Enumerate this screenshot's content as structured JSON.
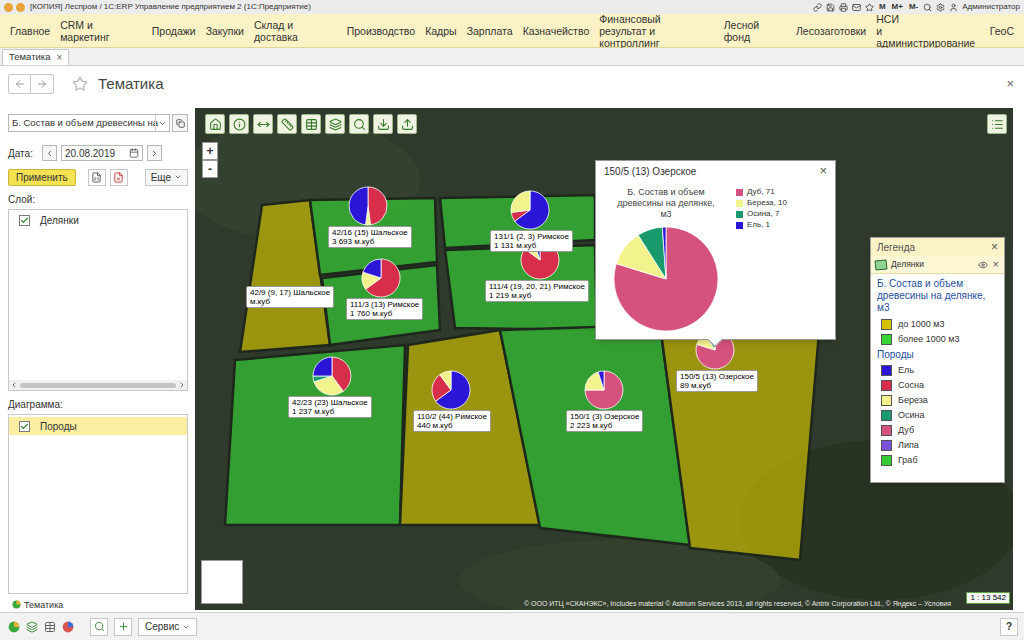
{
  "window": {
    "title": "[КОПИЯ] Леспром / 1С:ERP Управление предприятием 2 (1С:Предприятие)",
    "memory_buttons": [
      "M",
      "M+",
      "M-"
    ],
    "user": "Администратор"
  },
  "menu": [
    {
      "label": "Главное"
    },
    {
      "label": "CRM и маркетинг"
    },
    {
      "label": "Продажи"
    },
    {
      "label": "Закупки"
    },
    {
      "label": "Склад и доставка"
    },
    {
      "label": "Производство"
    },
    {
      "label": "Кадры"
    },
    {
      "label": "Зарплата"
    },
    {
      "label": "Казначейство"
    },
    {
      "label": "Финансовый\nрезультат и контроллинг"
    },
    {
      "label": "Лесной фонд"
    },
    {
      "label": "Лесозаготовки"
    },
    {
      "label": "НСИ\nи администрирование"
    },
    {
      "label": "ГеоС"
    }
  ],
  "tabs": [
    {
      "label": "Тематика",
      "close": "×",
      "selected": true
    }
  ],
  "form": {
    "title": "Тематика",
    "close": "×"
  },
  "left_panel": {
    "theme_select": "Б. Состав и объем древесины на",
    "date_label": "Дата:",
    "date": "20.08.2019",
    "apply_button": "Применить",
    "more_button": "Еще",
    "layers_label": "Слой:",
    "layers": [
      {
        "label": "Делянки",
        "checked": true,
        "selected": false
      }
    ],
    "diagrams_label": "Диаграмма:",
    "diagrams": [
      {
        "label": "Породы",
        "checked": true,
        "selected": true
      }
    ],
    "bottom_tab": "Тематика"
  },
  "map": {
    "zoom": [
      "+",
      "-"
    ],
    "parcels": [
      {
        "band": 0
      },
      {
        "band": 1
      },
      {
        "band": 1
      },
      {
        "band": 1
      },
      {
        "band": 1
      },
      {
        "band": 1
      },
      {
        "band": 0
      },
      {
        "band": 1
      },
      {
        "band": 0
      },
      {
        "band": 1
      }
    ],
    "plots": [
      {
        "label": "42/16 (15) Шальское",
        "volume": "3 693 м.куб",
        "slices": [
          {
            "species": "Сосна",
            "value": 48
          },
          {
            "species": "Береза",
            "value": 4
          },
          {
            "species": "Ель",
            "value": 48
          }
        ]
      },
      {
        "label": "111/4 (19, 20, 21) Римское",
        "volume": "1 219 м.куб",
        "slices": [
          {
            "species": "Сосна",
            "value": 85
          },
          {
            "species": "Береза",
            "value": 10
          },
          {
            "species": "Ель",
            "value": 5
          }
        ]
      },
      {
        "label": "131/1 (2, 3) Римское",
        "volume": "1 131 м.куб",
        "slices": [
          {
            "species": "Ель",
            "value": 65
          },
          {
            "species": "Сосна",
            "value": 8
          },
          {
            "species": "Береза",
            "value": 27
          }
        ]
      },
      {
        "label": "42/9 (9, 17) Шальское",
        "volume": "м.куб",
        "slices": []
      },
      {
        "label": "111/3 (13) Римское",
        "volume": "1 760 м.куб",
        "slices": [
          {
            "species": "Сосна",
            "value": 65
          },
          {
            "species": "Береза",
            "value": 15
          },
          {
            "species": "Ель",
            "value": 20
          }
        ]
      },
      {
        "label": "42/23 (23) Шальское",
        "volume": "1 237 м.куб",
        "slices": [
          {
            "species": "Сосна",
            "value": 40
          },
          {
            "species": "Береза",
            "value": 30
          },
          {
            "species": "Осина",
            "value": 5
          },
          {
            "species": "Ель",
            "value": 25
          }
        ]
      },
      {
        "label": "110/2 (44) Римское",
        "volume": "440 м.куб",
        "slices": [
          {
            "species": "Ель",
            "value": 65
          },
          {
            "species": "Сосна",
            "value": 25
          },
          {
            "species": "Береза",
            "value": 10
          }
        ]
      },
      {
        "label": "150/1 (3) Озерское",
        "volume": "2 223 м.куб",
        "slices": [
          {
            "species": "Дуб",
            "value": 75
          },
          {
            "species": "Береза",
            "value": 20
          },
          {
            "species": "Ель",
            "value": 5
          }
        ]
      },
      {
        "label": "150/5 (13) Озерское",
        "volume": "89 м.куб",
        "slices": [
          {
            "species": "Дуб",
            "value": 71
          },
          {
            "species": "Береза",
            "value": 10
          },
          {
            "species": "Осина",
            "value": 7
          },
          {
            "species": "Ель",
            "value": 1
          }
        ]
      }
    ],
    "popup": {
      "title": "150/5 (13) Озерское",
      "close": "×",
      "chart_title": "Б. Состав и объем древесины на делянке, м3",
      "series": [
        {
          "label": "Дуб, 71",
          "species": "Дуб",
          "value": 71
        },
        {
          "label": "Береза, 10",
          "species": "Береза",
          "value": 10
        },
        {
          "label": "Осина, 7",
          "species": "Осина",
          "value": 7
        },
        {
          "label": "Ель, 1",
          "species": "Ель",
          "value": 1
        }
      ]
    },
    "scale": "1 : 13 542",
    "copyright": "© ООО ИТЦ «СКАНЭКС», Includes material © Astrium Services 2013, all rights reserved, © Antrix Corporation Ltd., © Яндекс – Условия"
  },
  "legend": {
    "title": "Легенда",
    "close": "×",
    "layer": "Делянки",
    "layer_close": "×",
    "theme_title": "Б. Состав и объем древесины на делянке, м3",
    "classes": [
      {
        "label": "до 1000 м3",
        "color": "#d4c400"
      },
      {
        "label": "более 1000 м3",
        "color": "#36d636"
      }
    ],
    "species_title": "Породы",
    "species": [
      {
        "name": "Ель",
        "color": "#2b16d8"
      },
      {
        "name": "Сосна",
        "color": "#d72f4b"
      },
      {
        "name": "Береза",
        "color": "#f3f38e"
      },
      {
        "name": "Осина",
        "color": "#189a6c"
      },
      {
        "name": "Дуб",
        "color": "#d4527d"
      },
      {
        "name": "Липа",
        "color": "#7b52e0"
      },
      {
        "name": "Граб",
        "color": "#33cc33"
      }
    ]
  },
  "bottom_bar": {
    "service_button": "Сервис",
    "help": "?"
  }
}
